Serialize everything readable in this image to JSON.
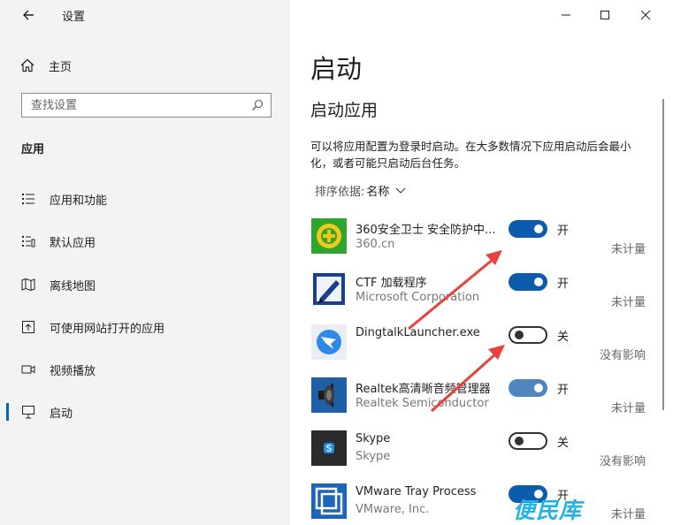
{
  "window": {
    "title": "设置"
  },
  "sidebar": {
    "home_label": "主页",
    "search": {
      "placeholder": "查找设置"
    },
    "section_title": "应用",
    "items": [
      {
        "label": "应用和功能",
        "icon": "list-icon"
      },
      {
        "label": "默认应用",
        "icon": "default-apps-icon"
      },
      {
        "label": "离线地图",
        "icon": "map-icon"
      },
      {
        "label": "可使用网站打开的应用",
        "icon": "open-in-web-icon"
      },
      {
        "label": "视频播放",
        "icon": "video-icon"
      },
      {
        "label": "启动",
        "icon": "startup-icon",
        "selected": true
      }
    ]
  },
  "main": {
    "title": "启动",
    "subtitle": "启动应用",
    "description": "可以将应用配置为登录时启动。在大多数情况下应用启动后会最小化，或者可能只启动后台任务。",
    "sort": {
      "label": "排序依据:",
      "value": "名称"
    },
    "apps": [
      {
        "name": "360安全卫士 安全防护中...",
        "publisher": "360.cn",
        "on": true,
        "state": "开",
        "impact": "未计量",
        "icon": "360-shield-icon"
      },
      {
        "name": "CTF 加载程序",
        "publisher": "Microsoft Corporation",
        "on": true,
        "state": "开",
        "impact": "未计量",
        "icon": "ctf-pen-icon"
      },
      {
        "name": "DingtalkLauncher.exe",
        "publisher": "",
        "on": false,
        "state": "关",
        "impact": "没有影响",
        "icon": "dingtalk-icon"
      },
      {
        "name": "Realtek高清晰音频管理器",
        "publisher": "Realtek Semiconductor",
        "on": true,
        "state": "开",
        "impact": "未计量",
        "icon": "speaker-icon"
      },
      {
        "name": "Skype",
        "publisher": "Skype",
        "on": false,
        "state": "关",
        "impact": "没有影响",
        "icon": "skype-icon"
      },
      {
        "name": "VMware Tray Process",
        "publisher": "VMware, Inc.",
        "on": true,
        "state": "开",
        "impact": "未计量",
        "icon": "vmware-icon"
      }
    ]
  },
  "watermark": "便民库",
  "colors": {
    "accent": "#0b5cad",
    "annotation_arrow": "#e8413c",
    "watermark": "#1fb3e6"
  }
}
